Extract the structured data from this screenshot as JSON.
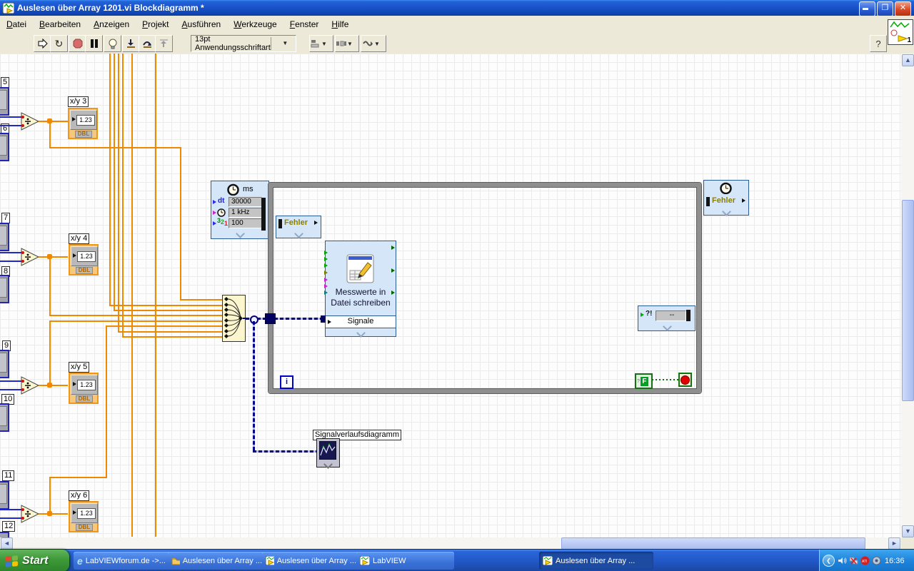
{
  "window": {
    "title": "Auslesen über Array 1201.vi Blockdiagramm *",
    "badge": "1",
    "help_label": "?"
  },
  "menu": {
    "items": [
      "Datei",
      "Bearbeiten",
      "Anzeigen",
      "Projekt",
      "Ausführen",
      "Werkzeuge",
      "Fenster",
      "Hilfe"
    ]
  },
  "toolbar": {
    "font_selector": "13pt Anwendungsschriftart"
  },
  "diagram": {
    "terminals": [
      {
        "num": "5"
      },
      {
        "num": "6"
      },
      {
        "num": "7"
      },
      {
        "num": "8"
      },
      {
        "num": "9"
      },
      {
        "num": "10"
      },
      {
        "num": "11"
      },
      {
        "num": "12"
      }
    ],
    "xy_indicators": [
      {
        "label": "x/y 3",
        "value": "1.23",
        "type": "DBL"
      },
      {
        "label": "x/y 4",
        "value": "1.23",
        "type": "DBL"
      },
      {
        "label": "x/y 5",
        "value": "1.23",
        "type": "DBL"
      },
      {
        "label": "x/y 6",
        "value": "1.23",
        "type": "DBL"
      }
    ],
    "timing_node": {
      "title": "ms",
      "rows": [
        {
          "label": "dt",
          "value": "30000"
        },
        {
          "value": "1 kHz"
        },
        {
          "value": "100"
        }
      ],
      "digits": {
        "a": "3",
        "b": "2",
        "c": "1"
      }
    },
    "error_in": "Fehler",
    "error_out": "Fehler",
    "write_vi": {
      "line1": "Messwerte in",
      "line2": "Datei schreiben",
      "port": "Signale"
    },
    "status_box": {
      "label": "?!",
      "value": "--"
    },
    "loop": {
      "iteration": "i",
      "stop_const": "F"
    },
    "chart_label": "Signalverlaufsdiagramm"
  },
  "taskbar": {
    "start": "Start",
    "buttons": [
      {
        "label": "LabVIEWforum.de ->..."
      },
      {
        "label": "Auslesen über Array ..."
      },
      {
        "label": "Auslesen über Array ..."
      },
      {
        "label": "LabVIEW"
      },
      {
        "label": "Auslesen über Array ..."
      }
    ],
    "tray": {
      "time": "16:36"
    }
  },
  "colors": {
    "wire_orange": "#EF8A00",
    "wire_navy": "#000080",
    "express_fill": "#D4E6F8",
    "express_border": "#2A5C9A",
    "loop_gray": "#8F8F8F",
    "xp_title_blue": "#1A53CC",
    "taskbar_blue": "#2258C8",
    "start_green": "#3E9A39"
  }
}
